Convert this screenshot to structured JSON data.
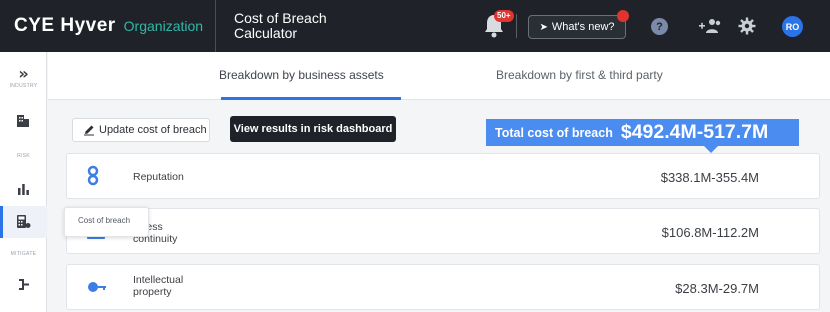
{
  "header": {
    "logo": "CYE Hyver",
    "organization": "Organization",
    "app_title": "Cost of Breach Calculator",
    "notifications_badge": "50+",
    "whats_new": "What's new?",
    "help": "?",
    "avatar_initials": "RO"
  },
  "rail": {
    "expand": "»",
    "sections": [
      {
        "label": "INDUSTRY"
      },
      {
        "label": "RISK"
      },
      {
        "label": "MITIGATE"
      }
    ],
    "tooltip": "Cost of breach"
  },
  "tabs": [
    {
      "label": "Breakdown by business assets",
      "active": true
    },
    {
      "label": "Breakdown by first & third party",
      "active": false
    }
  ],
  "actions": {
    "update_label": "Update cost of breach",
    "view_label": "View results in risk dashboard"
  },
  "total": {
    "label": "Total cost of breach",
    "value": "$492.4M-517.7M"
  },
  "assets": [
    {
      "name": "Reputation",
      "value": "$338.1M-355.4M",
      "icon": "reputation-icon"
    },
    {
      "name": "Business continuity",
      "name_visible": "siness",
      "name_line2": "continuity",
      "value": "$106.8M-112.2M",
      "icon": "business-continuity-icon"
    },
    {
      "name": "Intellectual property",
      "name_line1": "Intellectual",
      "name_line2": "property",
      "value": "$28.3M-29.7M",
      "icon": "intellectual-property-icon"
    }
  ],
  "colors": {
    "topbar": "#1f2329",
    "accent": "#2a73e8",
    "total_bg": "#4a8cf0",
    "org_text": "#2fb8a8",
    "badge": "#e0342f"
  }
}
